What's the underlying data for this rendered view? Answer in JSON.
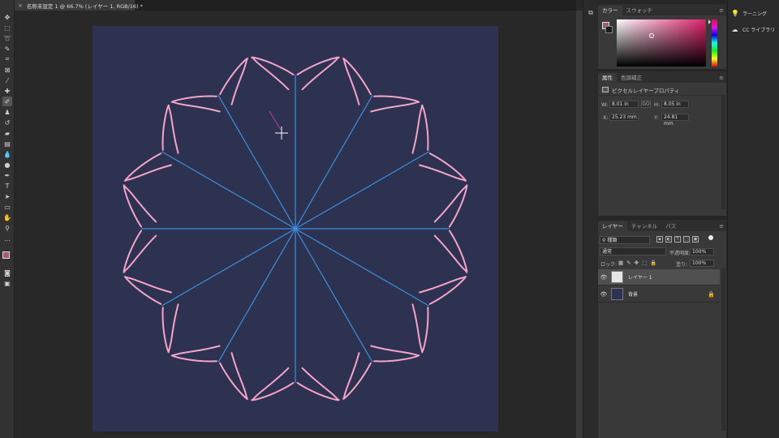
{
  "document": {
    "tab_title": "名称未設定 1 @ 66.7% (レイヤー 1, RGB/16) *",
    "close_glyph": "×"
  },
  "toolbar": {
    "tools": [
      "move-icon",
      "marquee-icon",
      "lasso-icon",
      "quick-select-icon",
      "crop-icon",
      "frame-icon",
      "eyedropper-icon",
      "healing-icon",
      "brush-icon",
      "stamp-icon",
      "history-brush-icon",
      "eraser-icon",
      "gradient-icon",
      "blur-icon",
      "dodge-icon",
      "pen-icon",
      "type-icon",
      "path-select-icon",
      "shape-icon",
      "hand-icon",
      "zoom-icon",
      "more-icon"
    ],
    "active_tool": "brush-icon",
    "foreground_color": "#a25a78",
    "background_color": "#1b1b1b"
  },
  "canvas": {
    "background": "#2d3250",
    "stroke_color": "#f6a3c9",
    "guide_color": "#3d8fe0"
  },
  "color_panel": {
    "tabs": [
      "カラー",
      "スウォッチ"
    ],
    "active_tab": "カラー",
    "hue_color": "#e0206a"
  },
  "properties_panel": {
    "tabs": [
      "属性",
      "色調補正"
    ],
    "active_tab": "属性",
    "subtitle": "ピクセルレイヤープロパティ",
    "w_label": "W:",
    "w_value": "8.01 in",
    "link_glyph": "GO",
    "h_label": "H:",
    "h_value": "8.05 in",
    "x_label": "X:",
    "x_value": "25.23 mm",
    "y_label": "Y:",
    "y_value": "24.81 mm"
  },
  "layers_panel": {
    "tabs": [
      "レイヤー",
      "チャンネル",
      "パス"
    ],
    "active_tab": "レイヤー",
    "filter_kind": "種類",
    "blend_mode": "通常",
    "opacity_label": "不透明度:",
    "opacity_value": "100%",
    "lock_label": "ロック:",
    "fill_label": "塗り:",
    "fill_value": "100%",
    "layers": [
      {
        "name": "レイヤー 1",
        "selected": true,
        "thumb_color": "#e6e6e6"
      },
      {
        "name": "背景",
        "selected": false,
        "thumb_color": "#2d3250",
        "locked": true
      }
    ]
  },
  "right_column": {
    "learn_label": "ラーニング",
    "libraries_label": "CC ライブラリ"
  }
}
